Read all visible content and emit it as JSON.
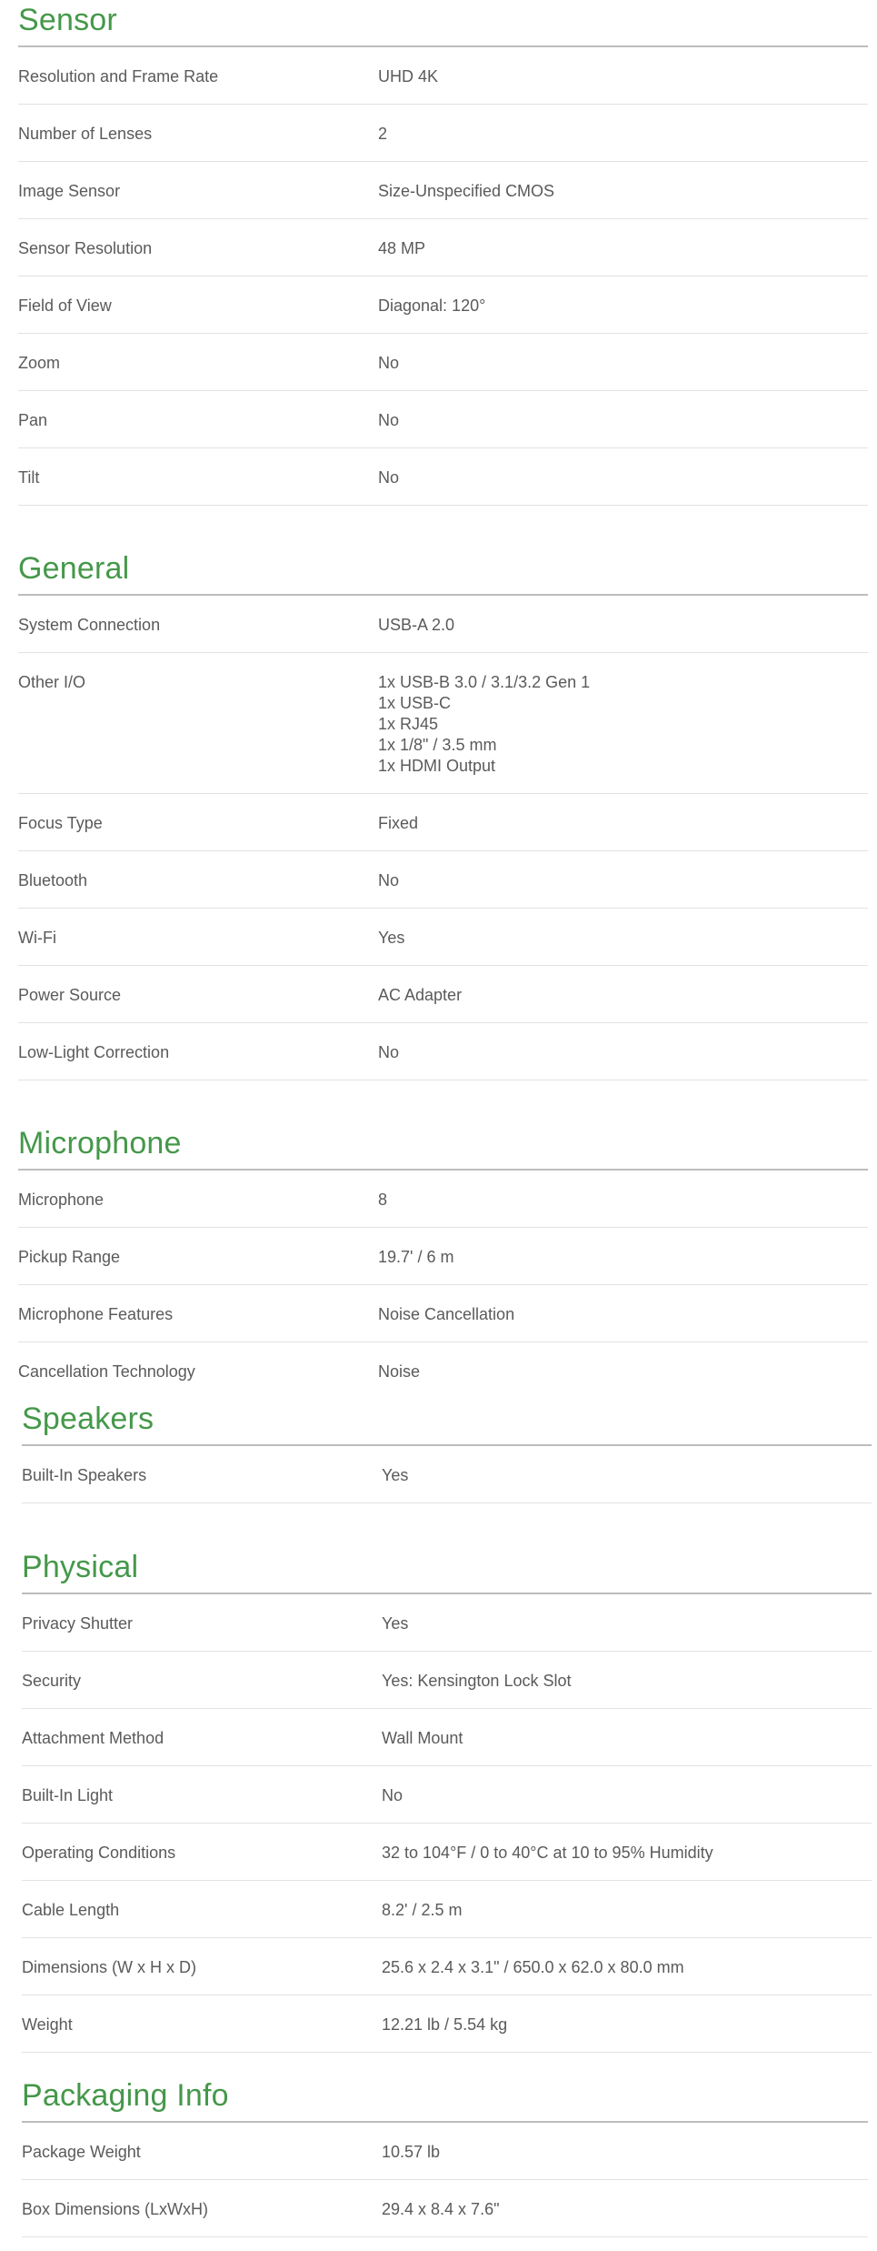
{
  "sections": [
    {
      "title": "Sensor",
      "rows": [
        {
          "label": "Resolution and Frame Rate",
          "value": [
            "UHD 4K"
          ]
        },
        {
          "label": "Number of Lenses",
          "value": [
            "2"
          ]
        },
        {
          "label": "Image Sensor",
          "value": [
            "Size-Unspecified CMOS"
          ]
        },
        {
          "label": "Sensor Resolution",
          "value": [
            "48 MP"
          ]
        },
        {
          "label": "Field of View",
          "value": [
            "Diagonal: 120°"
          ]
        },
        {
          "label": "Zoom",
          "value": [
            "No"
          ]
        },
        {
          "label": "Pan",
          "value": [
            "No"
          ]
        },
        {
          "label": "Tilt",
          "value": [
            "No"
          ]
        }
      ]
    },
    {
      "title": "General",
      "rows": [
        {
          "label": "System Connection",
          "value": [
            "USB-A 2.0"
          ]
        },
        {
          "label": "Other I/O",
          "value": [
            "1x USB-B 3.0 / 3.1/3.2 Gen 1",
            "1x USB-C",
            "1x RJ45",
            "1x 1/8\" / 3.5 mm",
            "1x HDMI Output"
          ]
        },
        {
          "label": "Focus Type",
          "value": [
            "Fixed"
          ]
        },
        {
          "label": "Bluetooth",
          "value": [
            "No"
          ]
        },
        {
          "label": "Wi-Fi",
          "value": [
            "Yes"
          ]
        },
        {
          "label": "Power Source",
          "value": [
            "AC Adapter"
          ]
        },
        {
          "label": "Low-Light Correction",
          "value": [
            "No"
          ]
        }
      ]
    },
    {
      "title": "Microphone",
      "rows": [
        {
          "label": "Microphone",
          "value": [
            "8"
          ]
        },
        {
          "label": "Pickup Range",
          "value": [
            "19.7' / 6 m"
          ]
        },
        {
          "label": "Microphone Features",
          "value": [
            "Noise Cancellation"
          ]
        },
        {
          "label": "Cancellation Technology",
          "value": [
            "Noise"
          ]
        }
      ]
    },
    {
      "title": "Speakers",
      "rows": [
        {
          "label": "Built-In Speakers",
          "value": [
            "Yes"
          ]
        }
      ]
    },
    {
      "title": "Physical",
      "rows": [
        {
          "label": "Privacy Shutter",
          "value": [
            "Yes"
          ]
        },
        {
          "label": "Security",
          "value": [
            "Yes: Kensington Lock Slot"
          ]
        },
        {
          "label": "Attachment Method",
          "value": [
            "Wall Mount"
          ]
        },
        {
          "label": "Built-In Light",
          "value": [
            "No"
          ]
        },
        {
          "label": "Operating Conditions",
          "value": [
            "32 to 104°F / 0 to 40°C at 10 to 95% Humidity"
          ]
        },
        {
          "label": "Cable Length",
          "value": [
            "8.2' / 2.5 m"
          ]
        },
        {
          "label": "Dimensions (W x H x D)",
          "value": [
            "25.6 x 2.4 x 3.1\" / 650.0 x 62.0 x 80.0 mm"
          ]
        },
        {
          "label": "Weight",
          "value": [
            "12.21 lb / 5.54 kg"
          ]
        }
      ]
    },
    {
      "title": "Packaging Info",
      "rows": [
        {
          "label": "Package Weight",
          "value": [
            "10.57 lb"
          ]
        },
        {
          "label": "Box Dimensions (LxWxH)",
          "value": [
            "29.4 x 8.4 x 7.6\""
          ]
        }
      ]
    }
  ],
  "colors": {
    "heading": "#45984a",
    "text": "#5a5a5a",
    "heading_rule": "#bdbdbd",
    "row_rule": "#e2e2e2"
  }
}
